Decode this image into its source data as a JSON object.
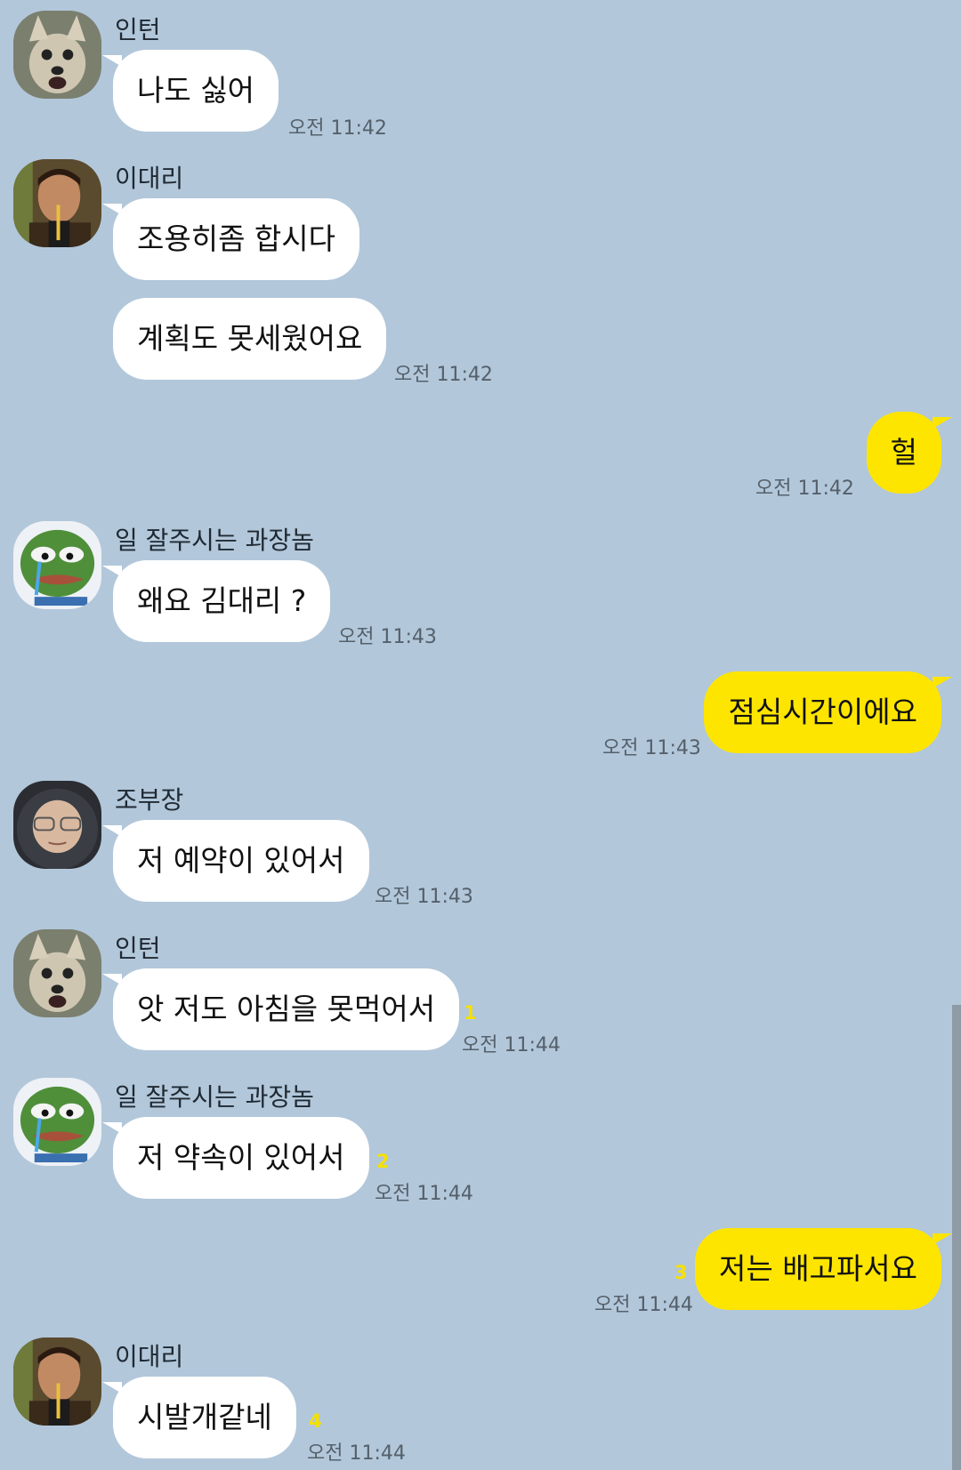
{
  "contacts": {
    "intern": "인턴",
    "lee": "이대리",
    "manager": "일 잘주시는 과장놈",
    "jo": "조부장"
  },
  "messages": [
    {
      "text": "나도 싫어",
      "time": "오전 11:42"
    },
    {
      "text": "조용히좀 합시다"
    },
    {
      "text": "계획도 못세웠어요",
      "time": "오전 11:42"
    },
    {
      "text": "헐",
      "time": "오전 11:42"
    },
    {
      "text": "왜요 김대리 ?",
      "time": "오전 11:43"
    },
    {
      "text": "점심시간이에요",
      "time": "오전 11:43"
    },
    {
      "text": "저 예약이 있어서",
      "time": "오전 11:43"
    },
    {
      "text": "앗 저도 아침을 못먹어서",
      "time": "오전 11:44",
      "unread": "1"
    },
    {
      "text": "저 약속이 있어서",
      "time": "오전 11:44",
      "unread": "2"
    },
    {
      "text": "저는 배고파서요",
      "time": "오전 11:44",
      "unread": "3"
    },
    {
      "text": "시발개같네",
      "time": "오전 11:44",
      "unread": "4"
    }
  ],
  "colors": {
    "background": "#b2c7da",
    "my_bubble": "#fee500",
    "other_bubble": "#ffffff",
    "unread": "#f6e000"
  },
  "icons": {
    "intern": "chihuahua-avatar",
    "lee": "man-avatar",
    "manager": "sad-frog-avatar",
    "jo": "hooded-person-avatar"
  }
}
